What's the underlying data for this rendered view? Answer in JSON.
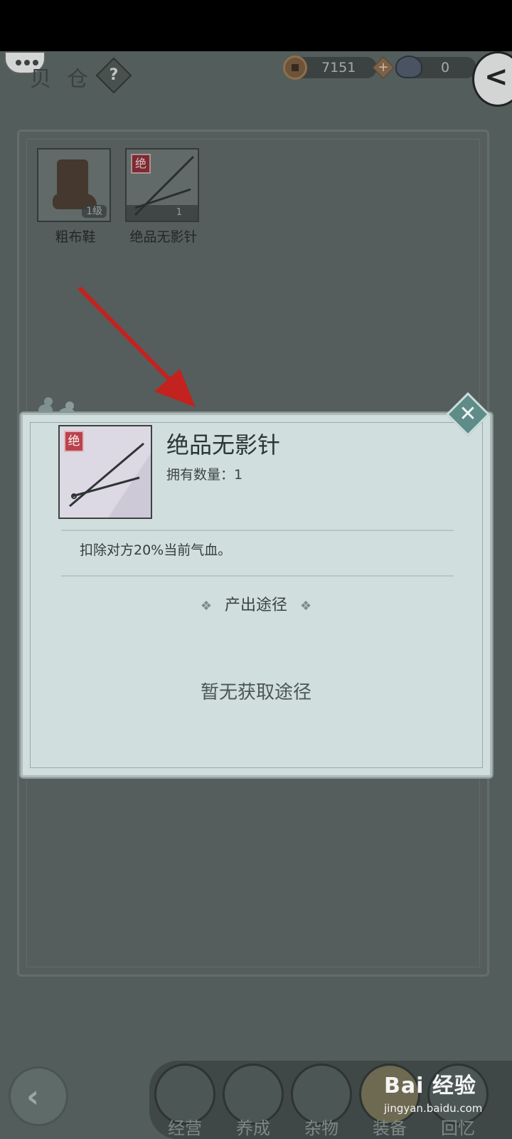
{
  "header": {
    "title": "贝仓",
    "help_label": "?",
    "coins": "7151",
    "plus_label": "+",
    "silver": "0",
    "back_label": "<"
  },
  "inventory": {
    "items": [
      {
        "name": "粗布鞋",
        "badge": "1级",
        "icon": "cloth-shoe-icon"
      },
      {
        "name": "绝品无影针",
        "grade": "绝",
        "qty": "1",
        "icon": "needle-icon"
      }
    ]
  },
  "detail": {
    "grade": "绝",
    "title": "绝品无影针",
    "owned_label": "拥有数量：1",
    "description": "扣除对方20%当前气血。",
    "section_title": "产出途径",
    "section_deco": "❖",
    "empty_source": "暂无获取途径",
    "close_label": "✕"
  },
  "nav": {
    "back_label": "‹",
    "tabs": [
      "经营",
      "养成",
      "杂物",
      "装备",
      "回忆"
    ]
  },
  "watermark": {
    "logo": "Bai 经验",
    "url": "jingyan.baidu.com"
  },
  "colors": {
    "annotation_arrow": "#e0201c",
    "modal_bg": "#d1dede",
    "grade_red": "#b8434e"
  }
}
